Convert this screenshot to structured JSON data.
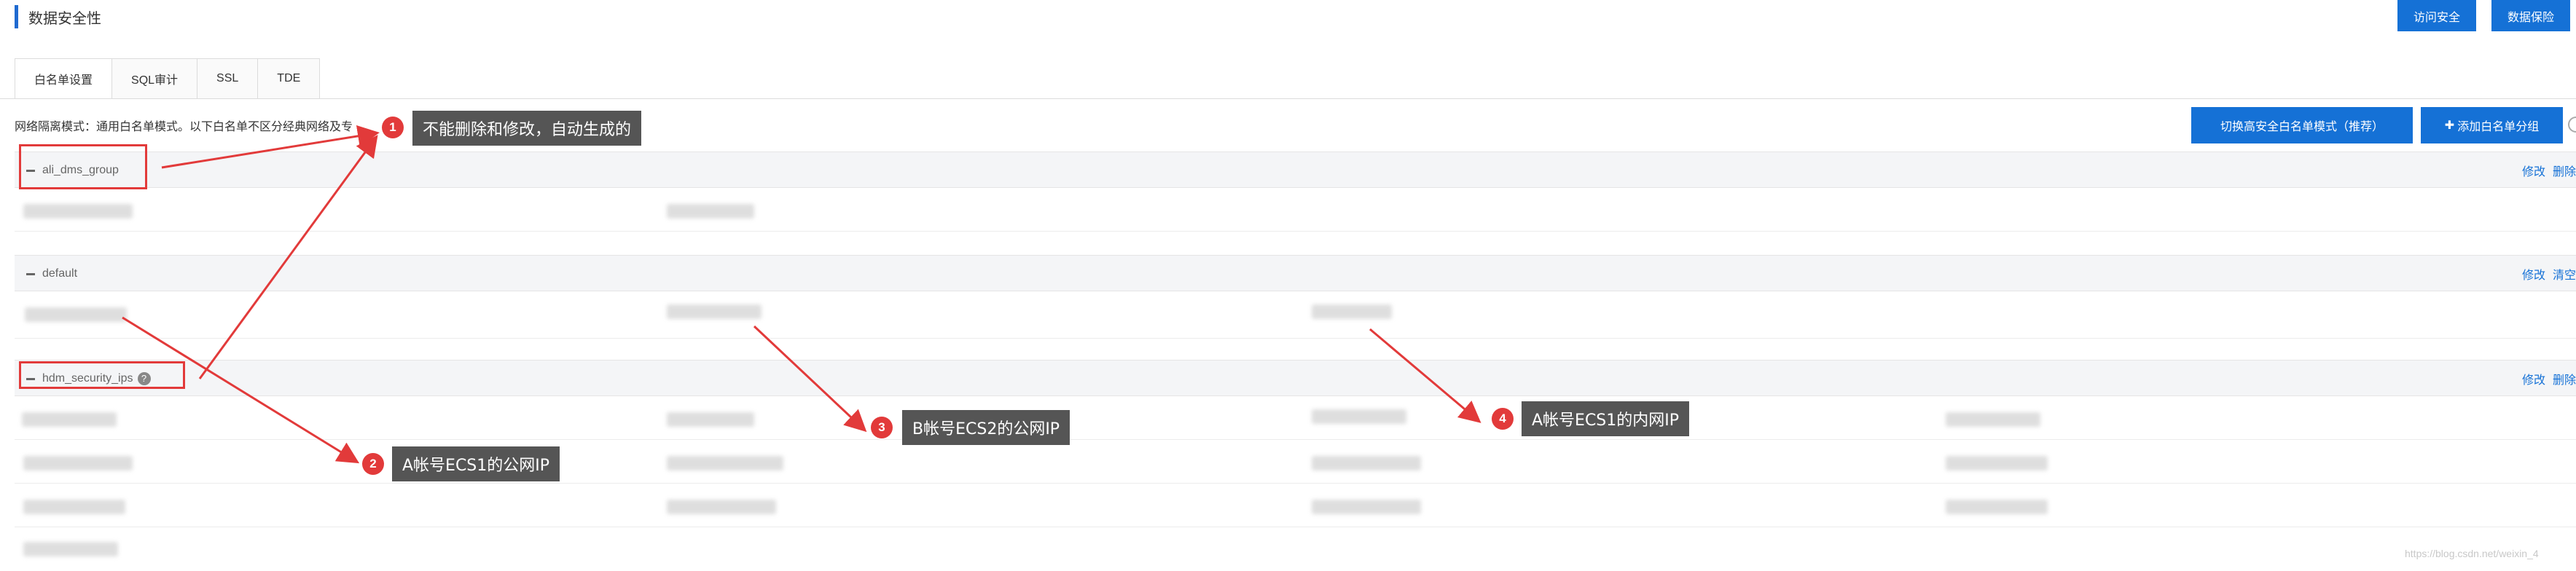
{
  "page": {
    "title": "数据安全性"
  },
  "header_buttons": {
    "access_security": "访问安全",
    "data_protection": "数据保险"
  },
  "tabs": [
    {
      "label": "白名单设置",
      "active": true
    },
    {
      "label": "SQL审计",
      "active": false
    },
    {
      "label": "SSL",
      "active": false
    },
    {
      "label": "TDE",
      "active": false
    }
  ],
  "mode": {
    "description": "网络隔离模式：通用白名单模式。以下白名单不区分经典网络及专",
    "switch_button": "切换高安全白名单模式（推荐）",
    "add_group_button": "添加白名单分组"
  },
  "groups": [
    {
      "name": "ali_dms_group",
      "actions": [
        "修改",
        "删除"
      ]
    },
    {
      "name": "default",
      "actions": [
        "修改",
        "清空"
      ]
    },
    {
      "name": "hdm_security_ips",
      "help": "?",
      "actions": [
        "修改",
        "删除"
      ]
    }
  ],
  "callouts": [
    {
      "number": "1",
      "text": "不能删除和修改，自动生成的"
    },
    {
      "number": "2",
      "text": "A帐号ECS1的公网IP"
    },
    {
      "number": "3",
      "text": "B帐号ECS2的公网IP"
    },
    {
      "number": "4",
      "text": "A帐号ECS1的内网IP"
    }
  ],
  "watermark": "https://blog.csdn.net/weixin_4",
  "colors": {
    "primary": "#1571d6",
    "annotation_red": "#e23a3a",
    "callout_bg": "#555555"
  }
}
